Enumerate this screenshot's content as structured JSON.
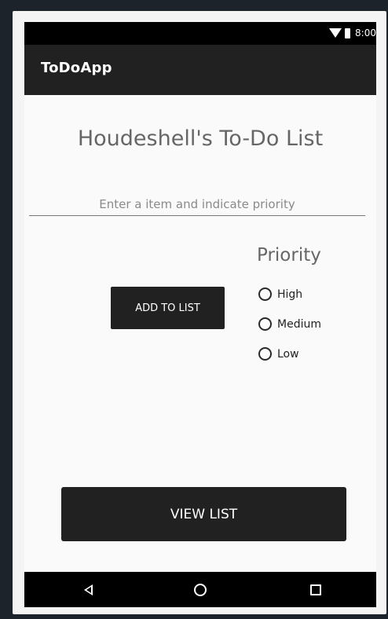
{
  "status_bar": {
    "time": "8:00",
    "icons": [
      "wifi-icon",
      "battery-icon"
    ]
  },
  "app_bar": {
    "title": "ToDoApp"
  },
  "main": {
    "heading": "Houdeshell's To-Do List",
    "item_input": {
      "placeholder": "Enter a item and indicate priority",
      "value": ""
    },
    "add_button_label": "ADD TO LIST",
    "priority": {
      "label": "Priority",
      "options": [
        "High",
        "Medium",
        "Low"
      ],
      "selected": null
    },
    "view_button_label": "VIEW LIST"
  },
  "nav_bar": {
    "icons": [
      "back-icon",
      "home-icon",
      "recents-icon"
    ]
  },
  "colors": {
    "app_bar": "#212121",
    "buttons": "#212121",
    "background": "#fafafa",
    "system_bars": "#000000"
  }
}
